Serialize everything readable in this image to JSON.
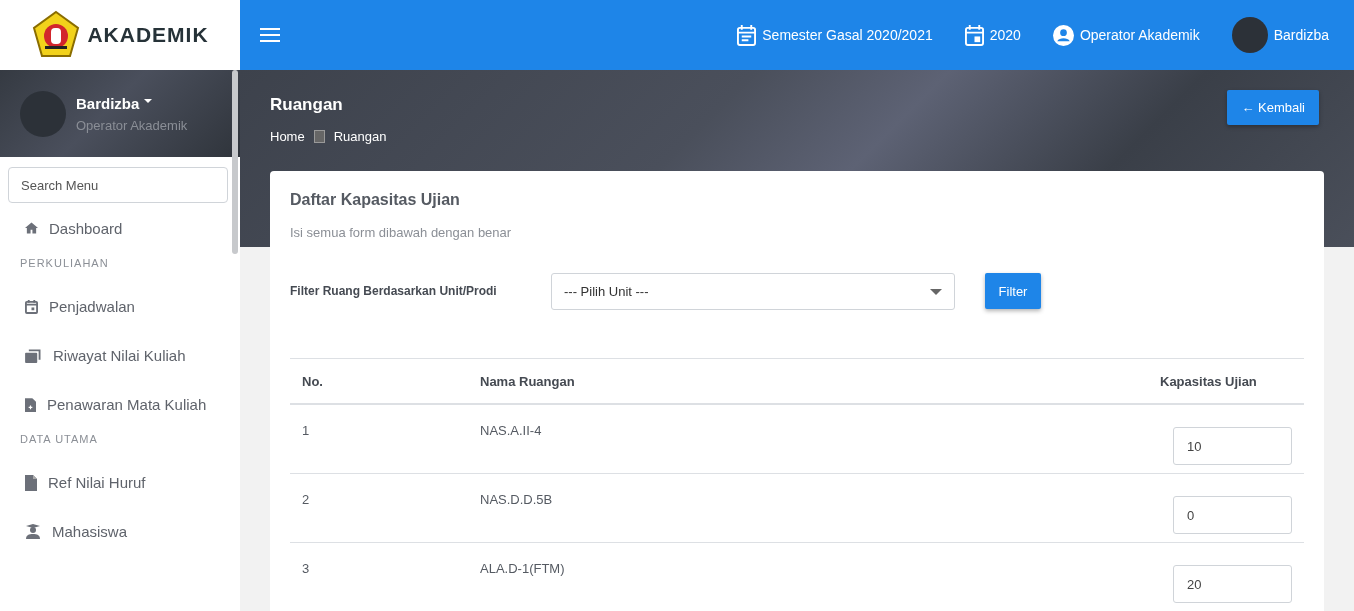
{
  "brand": {
    "name": "AKADEMIK"
  },
  "topbar": {
    "semester": "Semester Gasal 2020/2021",
    "year": "2020",
    "role": "Operator Akademik",
    "user": "Bardizba"
  },
  "sidebar": {
    "user": {
      "name": "Bardizba",
      "role": "Operator Akademik"
    },
    "search": {
      "placeholder": "Search Menu"
    },
    "items": [
      {
        "kind": "item",
        "label": "Dashboard"
      },
      {
        "kind": "header",
        "label": "PERKULIAHAN"
      },
      {
        "kind": "item",
        "label": "Penjadwalan"
      },
      {
        "kind": "item",
        "label": "Riwayat Nilai Kuliah"
      },
      {
        "kind": "item",
        "label": "Penawaran Mata Kuliah"
      },
      {
        "kind": "header",
        "label": "DATA UTAMA"
      },
      {
        "kind": "item",
        "label": "Ref Nilai Huruf"
      },
      {
        "kind": "item",
        "label": "Mahasiswa"
      }
    ]
  },
  "page": {
    "title": "Ruangan",
    "breadcrumb": [
      "Home",
      "Ruangan"
    ],
    "back_button": "← Kembali"
  },
  "card": {
    "title": "Daftar Kapasitas Ujian",
    "subtitle": "Isi semua form dibawah dengan benar",
    "filter": {
      "label": "Filter Ruang Berdasarkan Unit/Prodi",
      "select": "--- Pilih Unit ---",
      "button": "Filter"
    },
    "table": {
      "columns": [
        "No.",
        "Nama Ruangan",
        "Kapasitas Ujian"
      ],
      "rows": [
        {
          "no": "1",
          "name": "NAS.A.II-4",
          "capacity": "10"
        },
        {
          "no": "2",
          "name": "NAS.D.D.5B",
          "capacity": "0"
        },
        {
          "no": "3",
          "name": "ALA.D-1(FTM)",
          "capacity": "20"
        }
      ]
    }
  }
}
